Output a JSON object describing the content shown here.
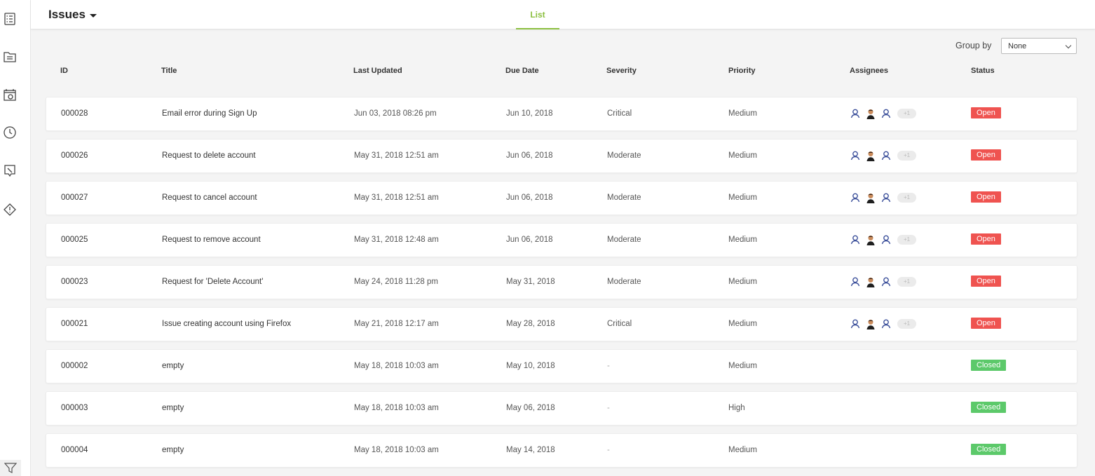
{
  "header": {
    "title": "Issues",
    "tab_label": "List"
  },
  "group_by": {
    "label": "Group by",
    "value": "None"
  },
  "columns": [
    "ID",
    "Title",
    "Last Updated",
    "Due Date",
    "Severity",
    "Priority",
    "Assignees",
    "Status"
  ],
  "rows": [
    {
      "id": "000028",
      "title": "Email error during Sign Up",
      "updated": "Jun 03, 2018 08:26 pm",
      "due": "Jun 10, 2018",
      "severity": "Critical",
      "priority": "Medium",
      "assignees_more": "+1",
      "status": "Open"
    },
    {
      "id": "000026",
      "title": "Request to delete account",
      "updated": "May 31, 2018 12:51 am",
      "due": "Jun 06, 2018",
      "severity": "Moderate",
      "priority": "Medium",
      "assignees_more": "+1",
      "status": "Open"
    },
    {
      "id": "000027",
      "title": "Request to cancel account",
      "updated": "May 31, 2018 12:51 am",
      "due": "Jun 06, 2018",
      "severity": "Moderate",
      "priority": "Medium",
      "assignees_more": "+1",
      "status": "Open"
    },
    {
      "id": "000025",
      "title": "Request to remove account",
      "updated": "May 31, 2018 12:48 am",
      "due": "Jun 06, 2018",
      "severity": "Moderate",
      "priority": "Medium",
      "assignees_more": "+1",
      "status": "Open"
    },
    {
      "id": "000023",
      "title": "Request for 'Delete Account'",
      "updated": "May 24, 2018 11:28 pm",
      "due": "May 31, 2018",
      "severity": "Moderate",
      "priority": "Medium",
      "assignees_more": "+1",
      "status": "Open"
    },
    {
      "id": "000021",
      "title": "Issue creating account using Firefox",
      "updated": "May 21, 2018 12:17 am",
      "due": "May 28, 2018",
      "severity": "Critical",
      "priority": "Medium",
      "assignees_more": "+1",
      "status": "Open"
    },
    {
      "id": "000002",
      "title": "empty",
      "updated": "May 18, 2018 10:03 am",
      "due": "May 10, 2018",
      "severity": "-",
      "priority": "Medium",
      "assignees_more": "",
      "status": "Closed"
    },
    {
      "id": "000003",
      "title": "empty",
      "updated": "May 18, 2018 10:03 am",
      "due": "May 06, 2018",
      "severity": "-",
      "priority": "High",
      "assignees_more": "",
      "status": "Closed"
    },
    {
      "id": "000004",
      "title": "empty",
      "updated": "May 18, 2018 10:03 am",
      "due": "May 14, 2018",
      "severity": "-",
      "priority": "Medium",
      "assignees_more": "",
      "status": "Closed"
    }
  ],
  "colors": {
    "accent": "#8bbf3f",
    "open": "#ef5350",
    "closed": "#5cc96a"
  },
  "sidebar_icons": [
    "checklist-icon",
    "folder-icon",
    "calendar-icon",
    "clock-icon",
    "map-icon",
    "warning-diamond-icon",
    "filter-icon"
  ]
}
